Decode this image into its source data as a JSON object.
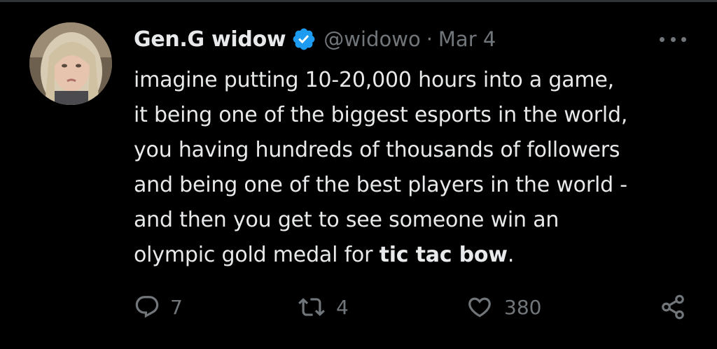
{
  "tweet": {
    "author_name": "Gen.G widow",
    "handle": "@widowo",
    "separator": "·",
    "date": "Mar 4",
    "verified_icon": "verified-badge-icon",
    "text_lines": [
      "imagine putting 10-20,000 hours into a game,",
      "it being one of the biggest esports in the world,",
      "you having hundreds of thousands of followers",
      "and being one of the best players in the world -",
      "and then you get to see someone win an"
    ],
    "last_line_prefix": "olympic gold medal for ",
    "last_line_bold": "tic tac bow",
    "last_line_suffix": "."
  },
  "actions": {
    "reply_count": "7",
    "retweet_count": "4",
    "like_count": "380"
  },
  "colors": {
    "background": "#000000",
    "text": "#e7e9ea",
    "muted": "#71767b",
    "verified": "#1d9bf0"
  }
}
